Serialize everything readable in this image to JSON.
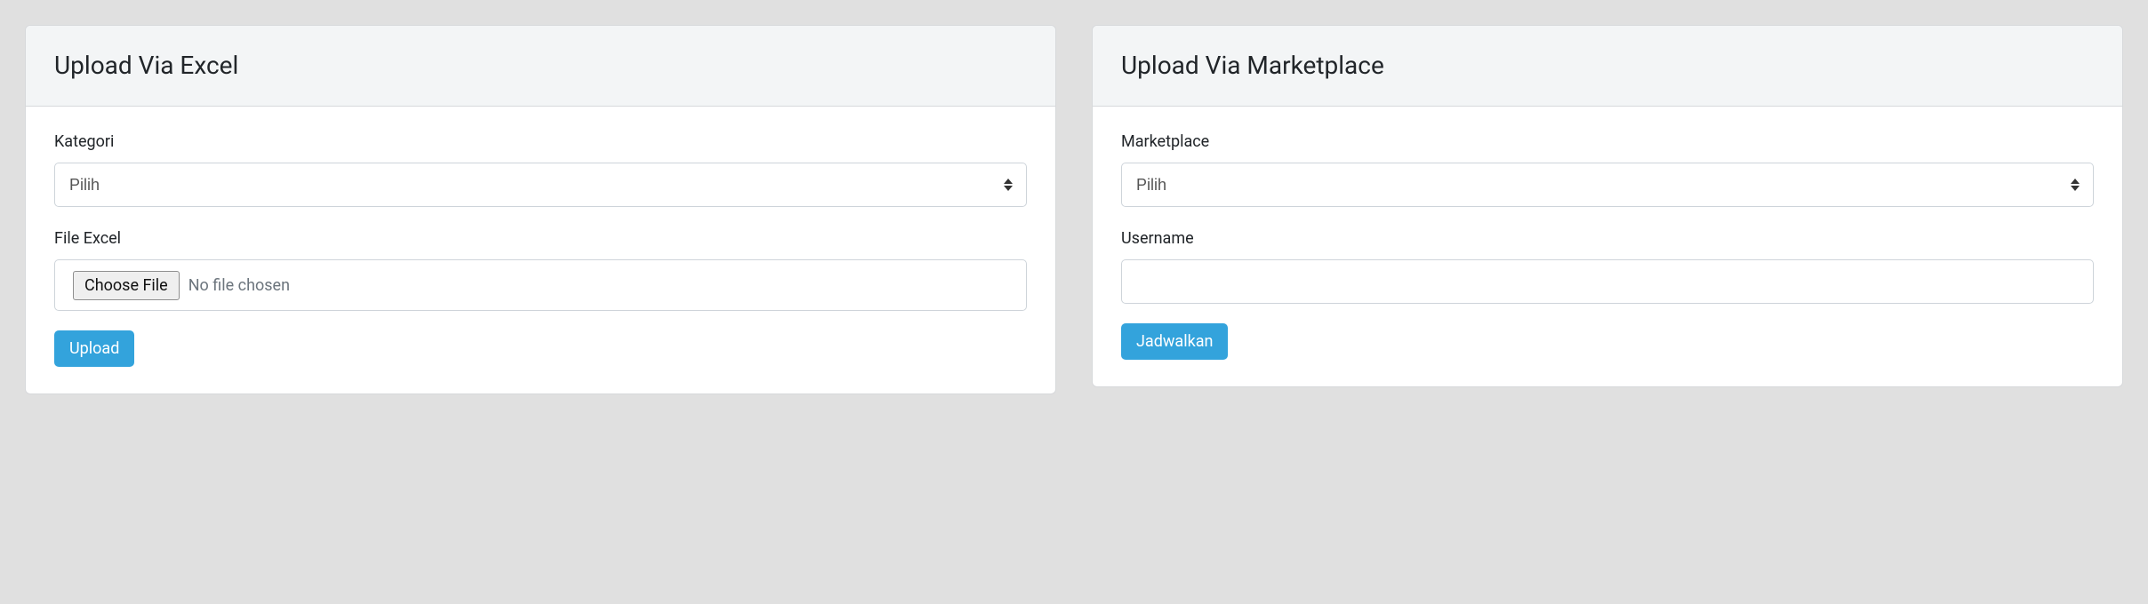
{
  "excel": {
    "title": "Upload Via Excel",
    "kategori_label": "Kategori",
    "kategori_selected": "Pilih",
    "file_label": "File Excel",
    "choose_file_btn": "Choose File",
    "no_file": "No file chosen",
    "upload_btn": "Upload"
  },
  "marketplace": {
    "title": "Upload Via Marketplace",
    "marketplace_label": "Marketplace",
    "marketplace_selected": "Pilih",
    "username_label": "Username",
    "username_value": "",
    "jadwalkan_btn": "Jadwalkan"
  }
}
